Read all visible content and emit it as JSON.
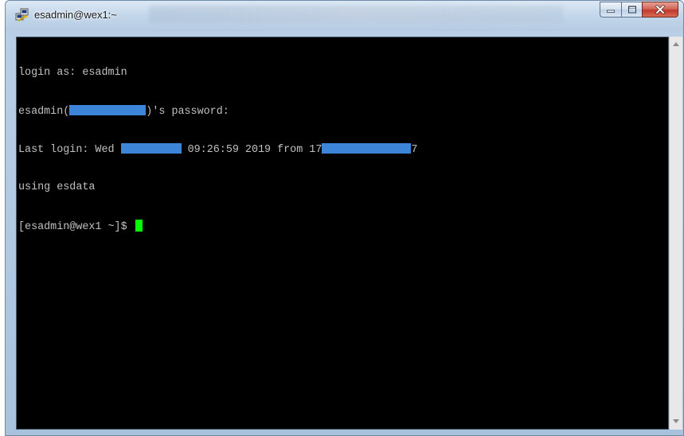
{
  "window": {
    "title": "esadmin@wex1:~"
  },
  "terminal": {
    "line1": "login as: esadmin",
    "line2_prefix": "esadmin(",
    "line2_suffix": ")'s password:",
    "line3_prefix": "Last login: Wed ",
    "line3_middle": " 09:26:59 2019 from 17",
    "line3_suffix": "7",
    "line4": "using esdata",
    "prompt": "[esadmin@wex1 ~]$ "
  },
  "colors": {
    "terminal_bg": "#000000",
    "terminal_fg": "#c0c0c0",
    "cursor": "#00ff00",
    "redaction": "#3d85d9"
  },
  "icons": {
    "app": "putty-icon",
    "minimize": "minimize-icon",
    "maximize": "maximize-icon",
    "close": "close-icon",
    "scroll_up": "chevron-up-icon",
    "scroll_down": "chevron-down-icon"
  }
}
